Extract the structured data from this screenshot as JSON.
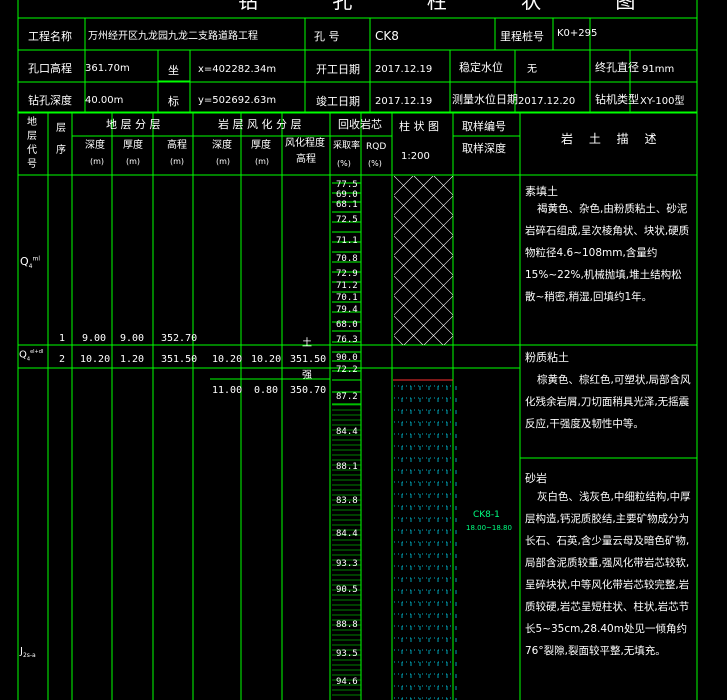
{
  "title": "钻 孔 柱 状 图",
  "header": {
    "project_label": "工程名称",
    "project_value": "万州经开区九龙园九龙二支路道路工程",
    "hole_label": "孔 号",
    "hole_value": "CK8",
    "mileage_label": "里程桩号",
    "mileage_value": "K0+295",
    "elevation_label": "孔口高程",
    "elevation_value": "361.70m",
    "coord_label_1": "坐",
    "coord_label_2": "标",
    "x_value": "x=402282.34m",
    "y_value": "y=502692.63m",
    "start_label": "开工日期",
    "start_value": "2017.12.19",
    "stable_label": "稳定水位",
    "stable_value": "无",
    "diameter_label": "终孔直径",
    "diameter_value": "91mm",
    "depth_label": "钻孔深度",
    "depth_value": "40.00m",
    "end_label": "竣工日期",
    "end_value": "2017.12.19",
    "water_date_label": "测量水位日期",
    "water_date_value": "2017.12.20",
    "rig_label": "钻机类型",
    "rig_value": "XY-100型"
  },
  "columns": {
    "geo_code": "地层代号",
    "layer_no": "层序",
    "layer_group": "地 层 分 层",
    "depth": "深度",
    "thickness": "厚度",
    "elev": "高程",
    "unit_m": "(m)",
    "weather_group": "岩 层 风 化 分 层",
    "w_depth": "深度",
    "w_thickness": "厚度",
    "w_degree": "风化程度",
    "w_elev": "高程",
    "recovery_group": "回收岩芯",
    "core_rate": "采取率",
    "rqd": "RQD",
    "pct": "(%)",
    "column_graph": "柱 状 图",
    "scale": "1:200",
    "sample_group": "取样编号",
    "sample_depth": "取样深度",
    "description": "岩 土 描 述"
  },
  "geo_codes": [
    {
      "main": "Q",
      "sup": "ml",
      "sub": "4"
    },
    {
      "main": "Q",
      "sup": "el+dl",
      "sub": "4"
    },
    {
      "main": "J",
      "sup": "",
      "sub": "2s-a"
    }
  ],
  "layers": [
    {
      "no": "1",
      "depth": "9.00",
      "thickness": "9.00",
      "elev": "352.70"
    },
    {
      "no": "2",
      "depth": "10.20",
      "thickness": "1.20",
      "elev": "351.50"
    }
  ],
  "weathering": [
    {
      "depth": "10.20",
      "thickness": "10.20",
      "elev": "351.50",
      "degree": "土"
    },
    {
      "depth": "11.00",
      "thickness": "0.80",
      "elev": "350.70",
      "degree": "强"
    }
  ],
  "core_rates": [
    "77.5",
    "69.0",
    "68.1",
    "72.5",
    "71.1",
    "70.8",
    "72.9",
    "71.2",
    "70.1",
    "79.4",
    "68.0",
    "76.3",
    "90.0",
    "72.2",
    "87.2",
    "84.4",
    "88.1",
    "83.8",
    "84.4",
    "93.3",
    "90.5",
    "88.8",
    "93.5",
    "94.6"
  ],
  "sample": {
    "id": "CK8-1",
    "depth": "18.00~18.80"
  },
  "descriptions": [
    {
      "title": "素填土",
      "text": "褐黄色、杂色,由粉质粘土、砂泥岩碎石组成,呈次棱角状、块状,硬质物粒径4.6~108mm,含量约15%~22%,机械抛填,堆土结构松散~稍密,稍湿,回填约1年。"
    },
    {
      "title": "粉质粘土",
      "text": "棕黄色、棕红色,可塑状,局部含风化残余岩屑,刀切面稍具光泽,无摇震反应,干强度及韧性中等。"
    },
    {
      "title": "砂岩",
      "text": "灰白色、浅灰色,中细粒结构,中厚层构造,钙泥质胶结,主要矿物成分为长石、石英,含少量云母及暗色矿物,局部含泥质较重,强风化带岩芯较软,呈碎块状,中等风化带岩芯较完整,岩质较硬,岩芯呈短柱状、柱状,岩芯节长5~35cm,28.40m处见一倾角约76°裂隙,裂面较平整,无填充。"
    }
  ],
  "colors": {
    "line": "#00ff00",
    "text": "#ffffff",
    "red": "#ff3030",
    "cyan": "#00e5ff",
    "sample": "#00ff80"
  }
}
